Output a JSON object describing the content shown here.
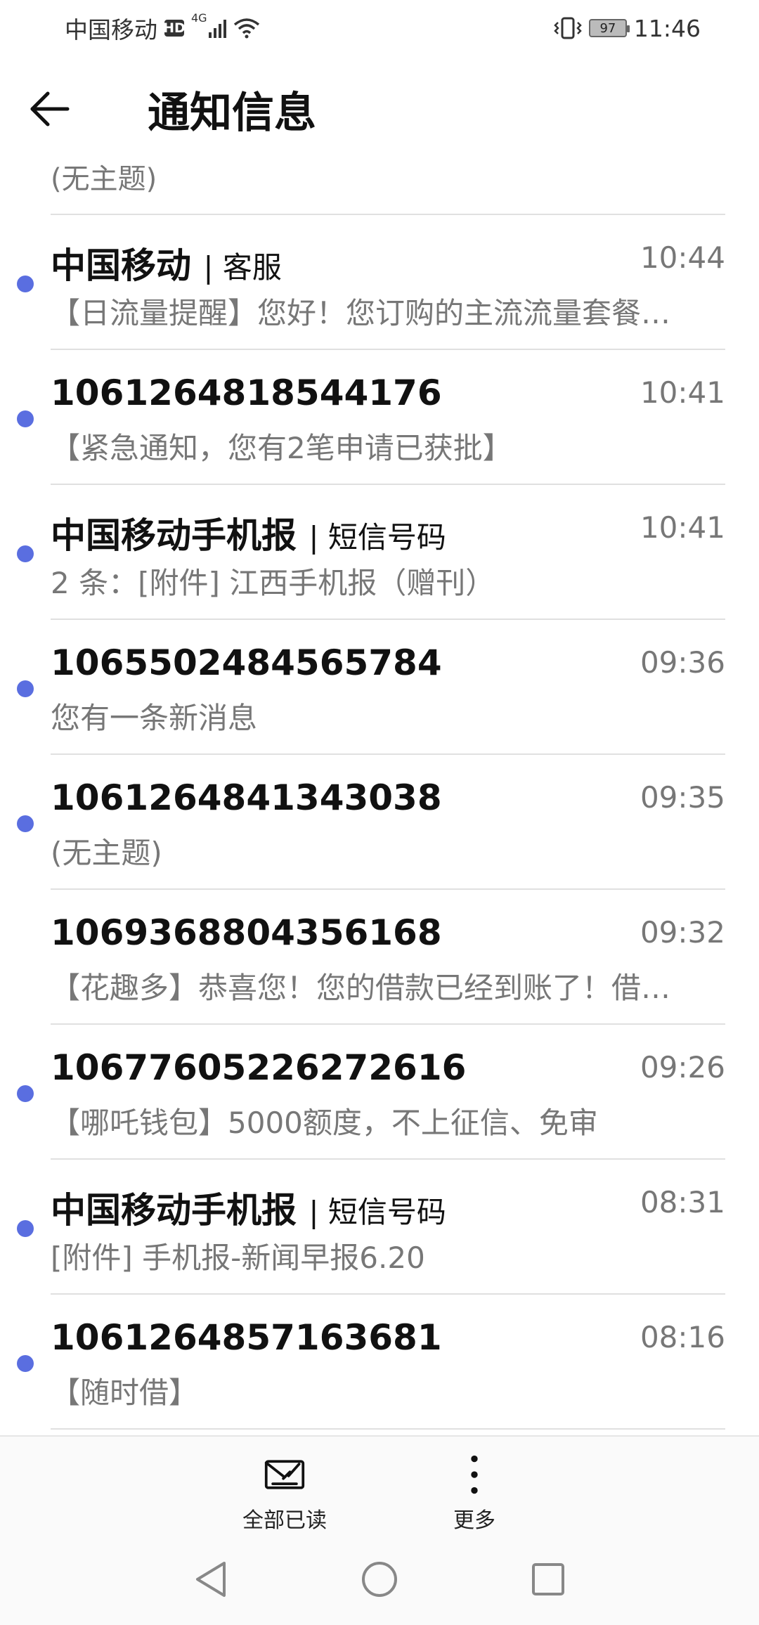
{
  "status_bar": {
    "carrier": "中国移动",
    "hd": "HD",
    "network": "4G",
    "battery": "97",
    "time": "11:46"
  },
  "header": {
    "title": "通知信息"
  },
  "partial_row": {
    "preview": "(无主题)"
  },
  "messages": [
    {
      "sender": "中国移动",
      "tag": "| 客服",
      "time": "10:44",
      "preview": "【日流量提醒】您好！您订购的主流流量套餐…",
      "unread": true
    },
    {
      "sender": "1061264818544176",
      "tag": "",
      "time": "10:41",
      "preview": "【紧急通知，您有2笔申请已获批】",
      "unread": true
    },
    {
      "sender": "中国移动手机报",
      "tag": "| 短信号码",
      "time": "10:41",
      "preview": "2 条：[附件] 江西手机报（赠刊）",
      "unread": true
    },
    {
      "sender": "1065502484565784",
      "tag": "",
      "time": "09:36",
      "preview": "您有一条新消息",
      "unread": true
    },
    {
      "sender": "1061264841343038",
      "tag": "",
      "time": "09:35",
      "preview": "(无主题)",
      "unread": true
    },
    {
      "sender": "1069368804356168",
      "tag": "",
      "time": "09:32",
      "preview": "【花趣多】恭喜您！您的借款已经到账了！借…",
      "unread": false
    },
    {
      "sender": "10677605226272616",
      "tag": "",
      "time": "09:26",
      "preview": "【哪吒钱包】5000额度，不上征信、免审",
      "unread": true
    },
    {
      "sender": "中国移动手机报",
      "tag": "| 短信号码",
      "time": "08:31",
      "preview": "[附件] 手机报-新闻早报6.20",
      "unread": true
    },
    {
      "sender": "1061264857163681",
      "tag": "",
      "time": "08:16",
      "preview": "【随时借】",
      "unread": true
    }
  ],
  "action_bar": {
    "mark_all_read": "全部已读",
    "more": "更多"
  },
  "icons": {
    "back": "arrow-left-icon",
    "mark_all_read": "mail-check-icon",
    "more": "vertical-dots-icon"
  },
  "colors": {
    "unread_dot": "#5a6ee0",
    "divider": "#e0e0e0",
    "secondary_text": "#777777"
  }
}
